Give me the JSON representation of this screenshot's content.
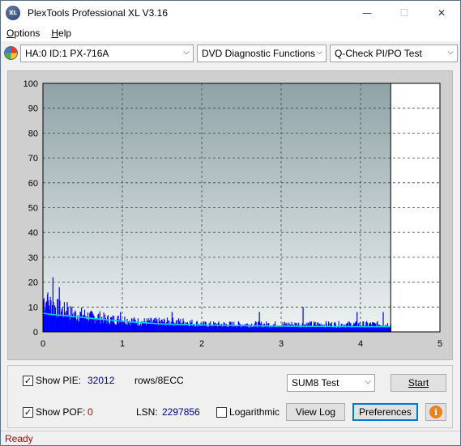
{
  "window": {
    "title": "PlexTools Professional XL V3.16",
    "icon_label": "XL",
    "minimize_glyph": "—",
    "maximize_glyph": "☐",
    "close_glyph": "✕"
  },
  "menu": {
    "items": [
      {
        "label": "Options",
        "accel": "O",
        "rest": "ptions"
      },
      {
        "label": "Help",
        "accel": "H",
        "rest": "elp"
      }
    ]
  },
  "toolbar": {
    "drive": "HA:0 ID:1  PX-716A",
    "function": "DVD Diagnostic Functions",
    "test": "Q-Check PI/PO Test",
    "arrow": "⌵"
  },
  "chart_data": {
    "type": "area",
    "xlabel": "",
    "ylabel": "",
    "xlim": [
      0,
      5
    ],
    "ylim": [
      0,
      100
    ],
    "x_ticks": [
      0,
      1,
      2,
      3,
      4,
      5
    ],
    "y_ticks": [
      0,
      10,
      20,
      30,
      40,
      50,
      60,
      70,
      80,
      90,
      100
    ],
    "data_end_x": 4.38,
    "grid": true,
    "background_color": "#8fa3a7",
    "series": [
      {
        "kind": "bars",
        "color": "#0000ff",
        "x": [
          0.0,
          0.05,
          0.1,
          0.15,
          0.2,
          0.3,
          0.4,
          0.5,
          0.6,
          0.7,
          0.8,
          0.9,
          1.0,
          1.2,
          1.4,
          1.6,
          1.8,
          2.0,
          2.2,
          2.4,
          2.6,
          2.8,
          3.0,
          3.2,
          3.4,
          3.6,
          3.8,
          4.0,
          4.2,
          4.38
        ],
        "values": [
          13,
          12,
          11,
          10,
          9,
          8,
          7,
          7,
          6,
          6,
          5,
          5,
          5,
          4,
          4,
          4,
          4,
          3,
          3,
          3,
          3,
          3,
          3,
          3,
          3,
          3,
          3,
          3,
          3,
          3
        ],
        "peaks": [
          {
            "x": 0.12,
            "y": 22
          },
          {
            "x": 0.2,
            "y": 18
          },
          {
            "x": 0.05,
            "y": 15
          },
          {
            "x": 0.3,
            "y": 12
          },
          {
            "x": 3.27,
            "y": 10
          },
          {
            "x": 2.72,
            "y": 8
          },
          {
            "x": 3.95,
            "y": 8
          },
          {
            "x": 4.28,
            "y": 8
          },
          {
            "x": 1.62,
            "y": 8
          },
          {
            "x": 0.97,
            "y": 8
          }
        ]
      },
      {
        "kind": "line",
        "color": "#00d0ff",
        "x": [
          0.0,
          0.1,
          0.3,
          0.5,
          0.7,
          0.9,
          1.1,
          1.3,
          1.5,
          1.7,
          2.0,
          2.5,
          3.0,
          3.5,
          4.0,
          4.38
        ],
        "values": [
          7.5,
          7,
          6.5,
          5.8,
          5.2,
          4.6,
          4.0,
          3.6,
          3.2,
          3.0,
          2.8,
          2.5,
          2.3,
          2.2,
          2.1,
          2.1
        ]
      }
    ]
  },
  "panel": {
    "show_pie_label": "Show PIE:",
    "show_pie_accel": "E",
    "show_pie_checked": true,
    "pie_value": "32012",
    "pie_unit": "rows/8ECC",
    "show_pof_label": "Show POF:",
    "show_pof_checked": true,
    "pof_value": "0",
    "lsn_label": "LSN:",
    "lsn_value": "2297856",
    "logarithmic_label": "Logarithmic",
    "logarithmic_checked": false,
    "sum_test_value": "SUM8 Test",
    "start_label": "Start",
    "viewlog_label": "View Log",
    "preferences_label": "Preferences",
    "info_glyph": "i",
    "check_glyph": "✓"
  },
  "status": {
    "text": "Ready"
  }
}
